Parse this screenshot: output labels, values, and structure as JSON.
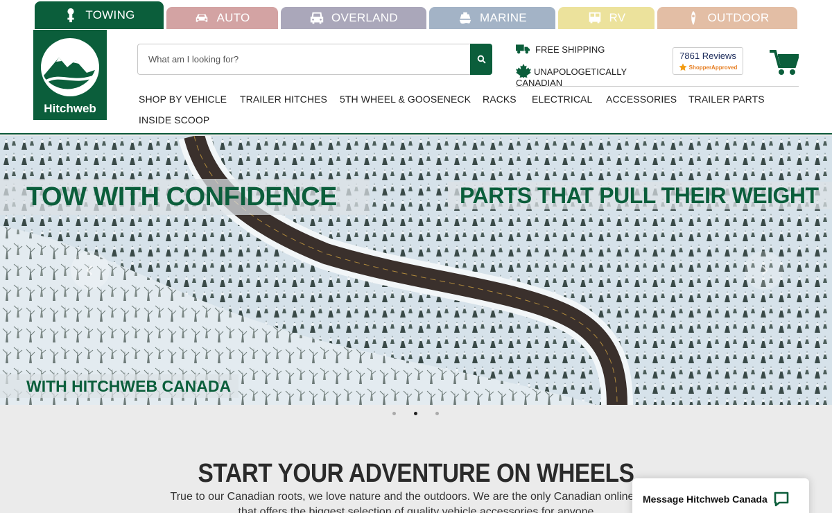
{
  "tabs": [
    {
      "label": "TOWING",
      "color": "#0b5e3b",
      "icon": "hitch-ball-icon",
      "active": true
    },
    {
      "label": "AUTO",
      "color": "#d3a3a3",
      "icon": "car-icon",
      "active": false
    },
    {
      "label": "OVERLAND",
      "color": "#aaa7ba",
      "icon": "jeep-icon",
      "active": false
    },
    {
      "label": "MARINE",
      "color": "#a3b3c6",
      "icon": "boat-icon",
      "active": false
    },
    {
      "label": "RV",
      "color": "#ece29c",
      "icon": "rv-icon",
      "active": false
    },
    {
      "label": "OUTDOOR",
      "color": "#e3bea5",
      "icon": "kayak-icon",
      "active": false
    }
  ],
  "header": {
    "logo_text": "Hitchweb",
    "search_placeholder": "What am I looking for?",
    "perks": {
      "shipping": "FREE SHIPPING",
      "canadian": "UNAPOLOGETICALLY CANADIAN"
    },
    "reviews": {
      "count_label": "7861 Reviews",
      "badge": "ShopperApproved"
    }
  },
  "nav": {
    "items": [
      "SHOP BY VEHICLE",
      "TRAILER HITCHES",
      "5TH WHEEL & GOOSENECK",
      "RACKS",
      "ELECTRICAL",
      "ACCESSORIES",
      "TRAILER PARTS",
      "INSIDE SCOOP"
    ]
  },
  "hero": {
    "headline": "TOW WITH CONFIDENCE",
    "tagline": "PARTS THAT PULL THEIR WEIGHT",
    "subline": "WITH HITCHWEB CANADA",
    "slides_total": 3,
    "active_slide": 2
  },
  "section": {
    "title": "START YOUR ADVENTURE ON WHEELS",
    "intro": "True to our Canadian roots, we love nature and the outdoors. We are the only Canadian online store that offers the biggest selection of quality vehicle accessories for anyone"
  },
  "chat": {
    "label": "Message Hitchweb Canada"
  },
  "colors": {
    "brand_green": "#0b5e3b"
  }
}
